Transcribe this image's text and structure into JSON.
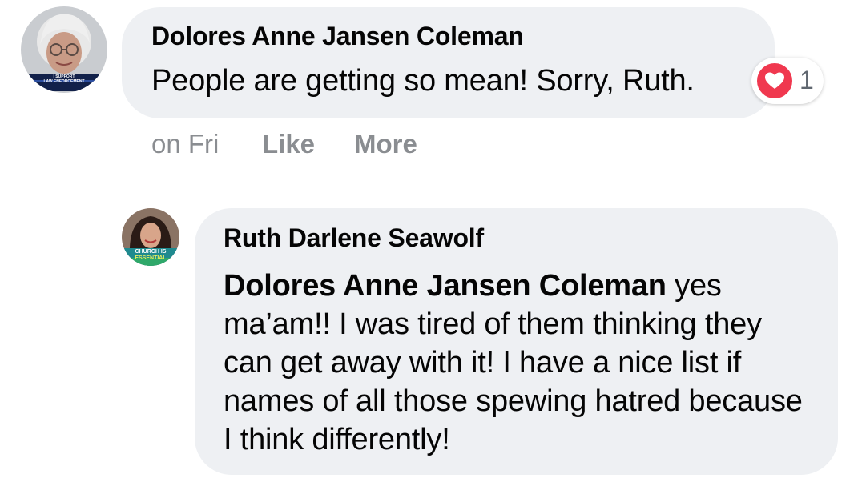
{
  "comment": {
    "author": "Dolores Anne Jansen Coleman",
    "text": "People are getting so mean! Sorry, Ruth.",
    "reaction": {
      "icon": "heart-icon",
      "count": "1",
      "color": "#f0384f"
    },
    "avatar_badge_lines": [
      "I SUPPORT",
      "LAW ENFORCEMENT"
    ],
    "actions": {
      "time": "on Fri",
      "like": "Like",
      "more": "More"
    }
  },
  "reply": {
    "author": "Ruth Darlene Seawolf",
    "mention": "Dolores Anne Jansen Coleman",
    "text": " yes ma’am!! I was tired of them thinking they can get away with it! I have a nice list if names of all those spewing hatred because I think differently!",
    "avatar_badge_lines": [
      "CHURCH IS",
      "ESSENTIAL"
    ]
  },
  "colors": {
    "bubble": "#eef0f3",
    "meta_text": "#8a8d91",
    "body_text": "#050505"
  }
}
